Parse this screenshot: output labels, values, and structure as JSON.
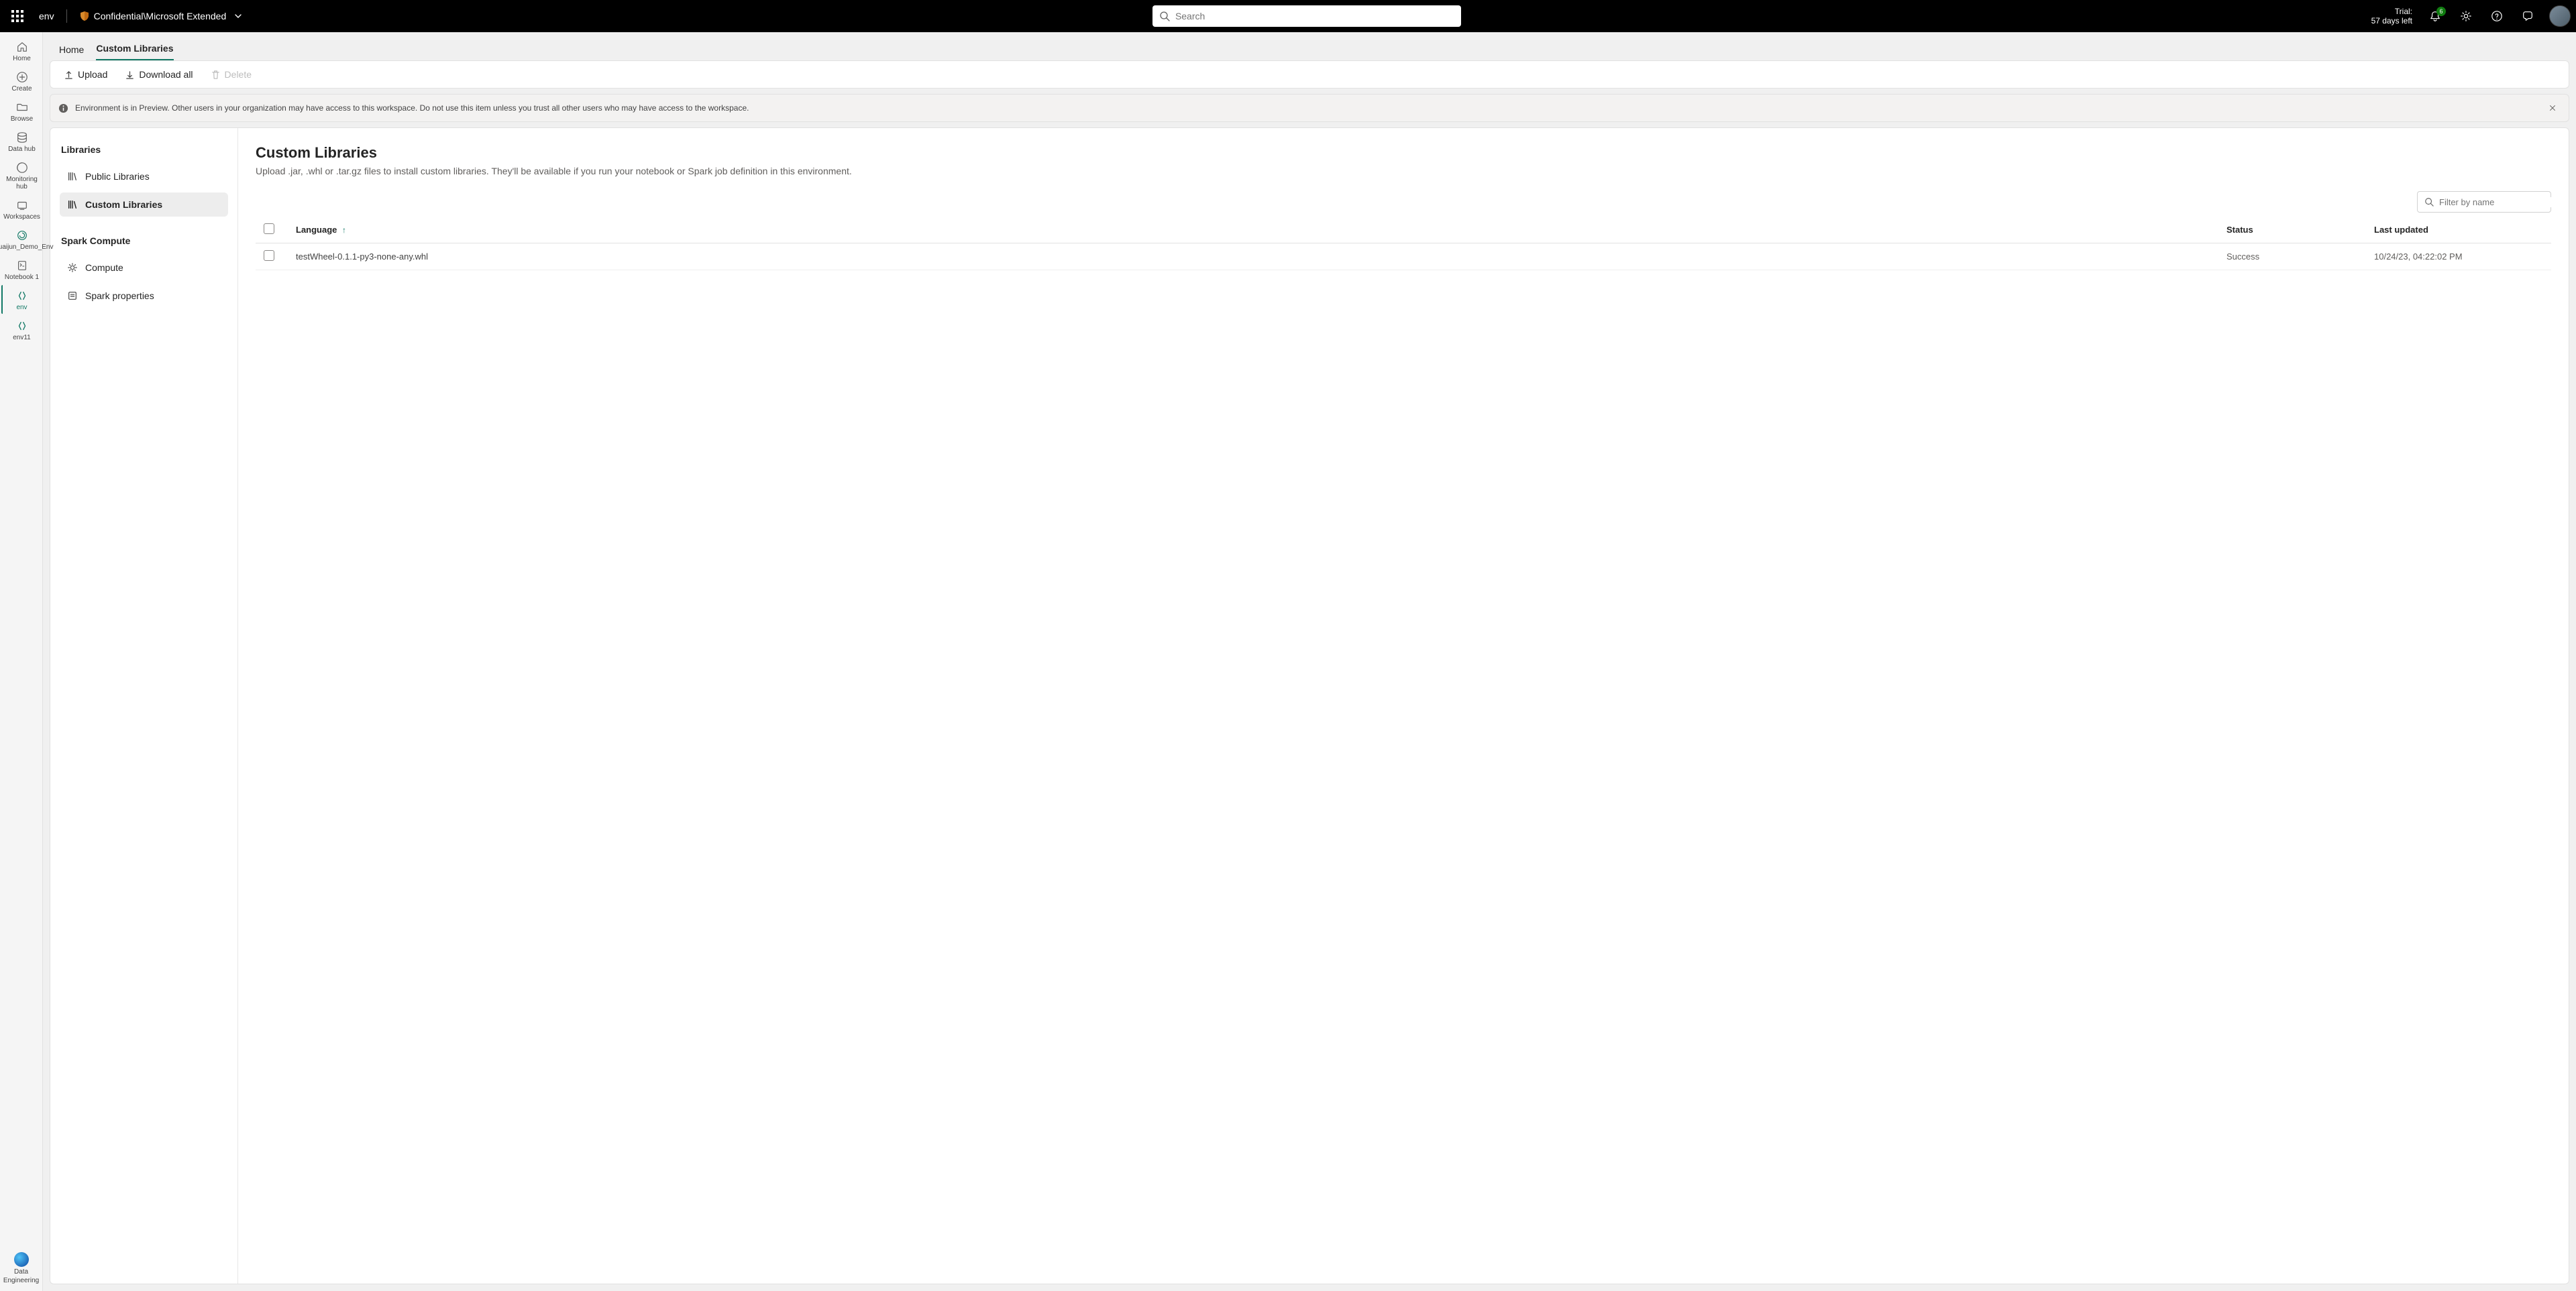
{
  "header": {
    "env_name": "env",
    "sensitivity_label": "Confidential\\Microsoft Extended",
    "search_placeholder": "Search",
    "trial_line1": "Trial:",
    "trial_line2": "57 days left",
    "notification_count": "6"
  },
  "left_rail": {
    "items": [
      {
        "id": "home",
        "label": "Home"
      },
      {
        "id": "create",
        "label": "Create"
      },
      {
        "id": "browse",
        "label": "Browse"
      },
      {
        "id": "datahub",
        "label": "Data hub"
      },
      {
        "id": "monitoring",
        "label": "Monitoring hub"
      },
      {
        "id": "workspaces",
        "label": "Workspaces"
      },
      {
        "id": "ws1",
        "label": "Shuaijun_Demo_Env"
      },
      {
        "id": "notebook1",
        "label": "Notebook 1"
      },
      {
        "id": "env",
        "label": "env"
      },
      {
        "id": "env11",
        "label": "env11"
      }
    ],
    "bottom": {
      "label1": "Data",
      "label2": "Engineering"
    }
  },
  "tabs": {
    "home": "Home",
    "custom_libraries": "Custom Libraries"
  },
  "toolbar": {
    "upload": "Upload",
    "download_all": "Download all",
    "delete": "Delete"
  },
  "banner": {
    "text": "Environment is in Preview. Other users in your organization may have access to this workspace. Do not use this item unless you trust all other users who may have access to the workspace."
  },
  "side_nav": {
    "libraries_title": "Libraries",
    "public_libraries": "Public Libraries",
    "custom_libraries": "Custom Libraries",
    "spark_compute_title": "Spark Compute",
    "compute": "Compute",
    "spark_properties": "Spark properties"
  },
  "main": {
    "title": "Custom Libraries",
    "description": "Upload .jar, .whl or .tar.gz files to install custom libraries. They'll be available if you run your notebook or Spark job definition in this environment.",
    "filter_placeholder": "Filter by name",
    "columns": {
      "language": "Language",
      "status": "Status",
      "last_updated": "Last updated"
    },
    "rows": [
      {
        "name": "testWheel-0.1.1-py3-none-any.whl",
        "status": "Success",
        "updated": "10/24/23, 04:22:02 PM"
      }
    ]
  }
}
